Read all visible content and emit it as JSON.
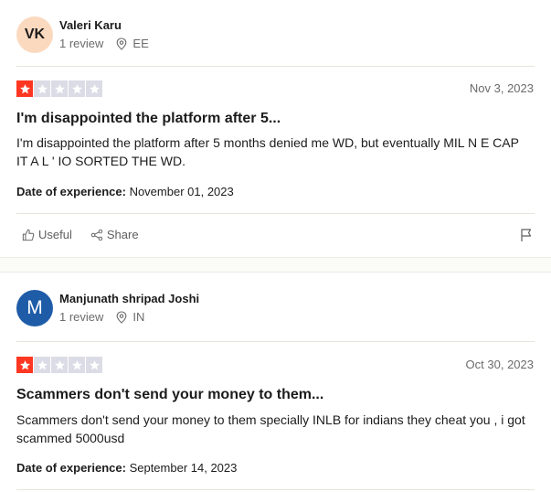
{
  "reviews": [
    {
      "avatar_initials": "VK",
      "name": "Valeri Karu",
      "review_count": "1 review",
      "country": "EE",
      "rating": 1,
      "date": "Nov 3, 2023",
      "title": "I'm disappointed the platform after 5...",
      "text": "I'm disappointed the platform after 5 months denied me WD, but eventually MIL N E CAP IT A L ' IO SORTED THE WD.",
      "experience_label": "Date of experience:",
      "experience_date": "November 01, 2023",
      "useful_label": "Useful",
      "share_label": "Share"
    },
    {
      "avatar_initials": "M",
      "name": "Manjunath shripad Joshi",
      "review_count": "1 review",
      "country": "IN",
      "rating": 1,
      "date": "Oct 30, 2023",
      "title": "Scammers don't send your money to them...",
      "text": "Scammers don't send your money to them specially INLB for indians they cheat you , i got scammed 5000usd",
      "experience_label": "Date of experience:",
      "experience_date": "September 14, 2023"
    }
  ],
  "colors": {
    "star_filled": "#ff3722",
    "star_empty": "#dcdce6",
    "avatar_vk_bg": "#fbd9bf",
    "avatar_m_bg": "#1f5ca8"
  },
  "icons": [
    "location-pin-icon",
    "thumbs-up-icon",
    "share-icon",
    "flag-icon",
    "star-icon"
  ]
}
